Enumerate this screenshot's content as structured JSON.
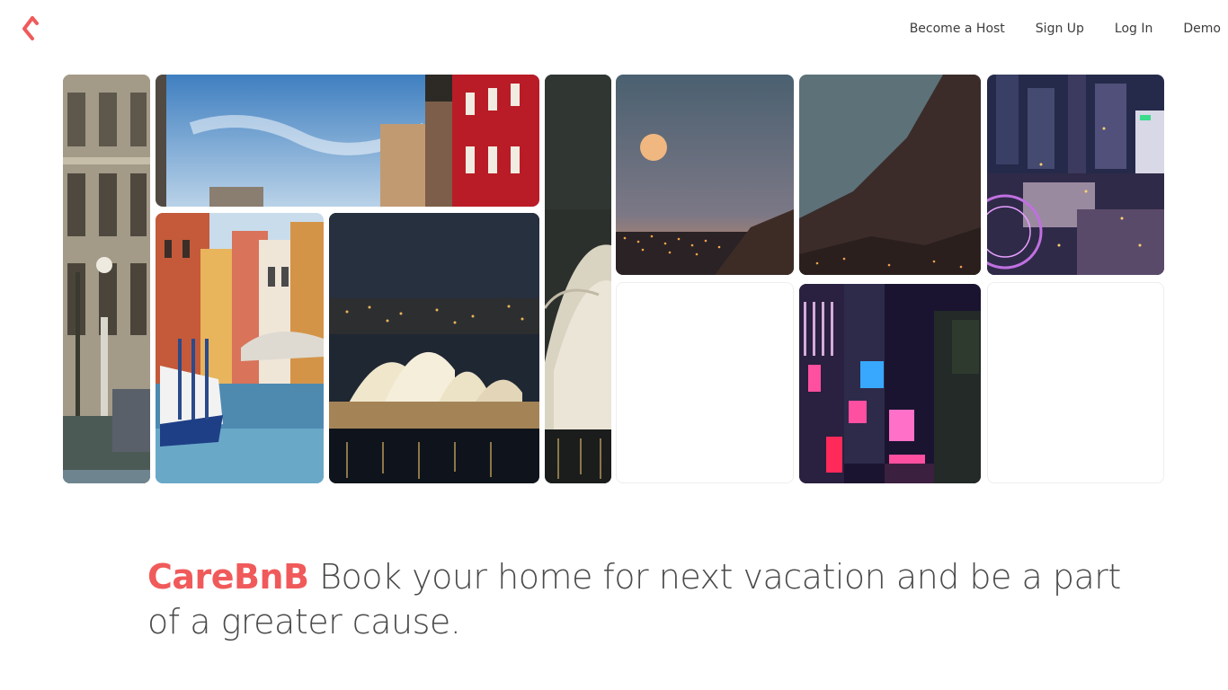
{
  "header": {
    "logo_icon": "carebnb-logo-icon",
    "nav": [
      {
        "label": "Become a Host"
      },
      {
        "label": "Sign Up"
      },
      {
        "label": "Log In"
      },
      {
        "label": "Demo"
      }
    ]
  },
  "gallery": {
    "images": [
      {
        "name": "venice-palazzo-image"
      },
      {
        "name": "venice-red-building-image"
      },
      {
        "name": "venice-canal-image"
      },
      {
        "name": "sydney-opera-house-image"
      },
      {
        "name": "opera-house-closeup-image"
      },
      {
        "name": "full-moon-city-night-image"
      },
      {
        "name": "mountain-dusk-image"
      },
      {
        "name": "city-ferris-wheel-night-image"
      },
      {
        "name": "tokyo-neon-street-image"
      }
    ]
  },
  "hero": {
    "brand": "CareBnB",
    "text": "Book your home for next vacation and be a part of a greater cause."
  },
  "colors": {
    "accent": "#f05a5a",
    "text": "#4a4a4a"
  }
}
